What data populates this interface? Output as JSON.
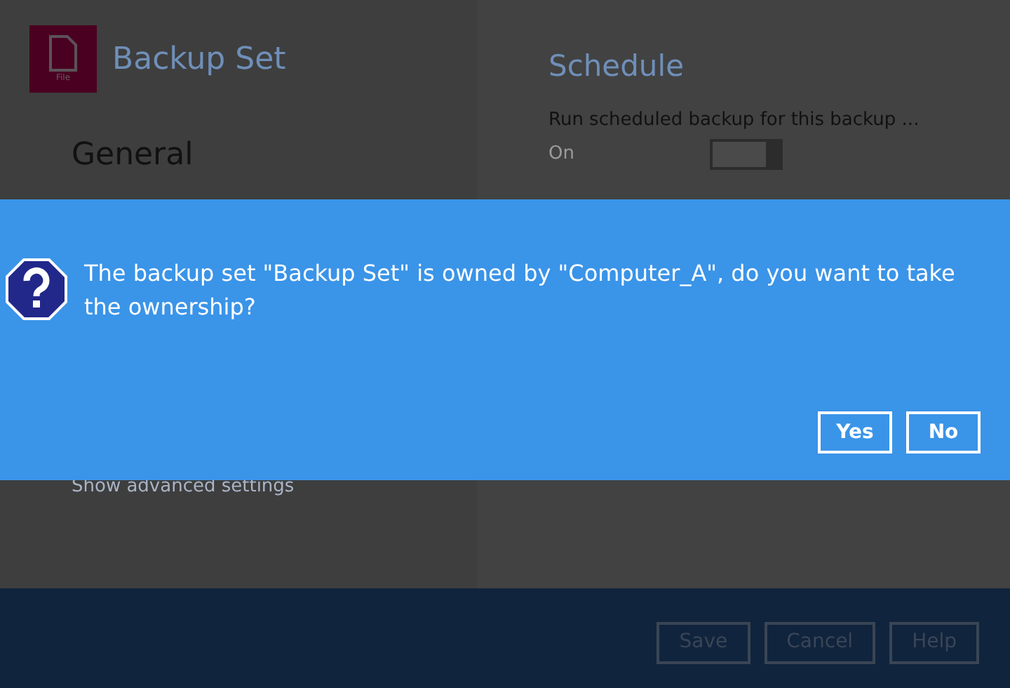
{
  "sidebar": {
    "icon_label": "File",
    "title": "Backup Set",
    "section": "General",
    "advanced_link": "Show advanced settings"
  },
  "schedule": {
    "title": "Schedule",
    "setting_label": "Run scheduled backup for this backup ...",
    "state_label": "On",
    "on": true
  },
  "dialog": {
    "message": "The backup set \"Backup Set\" is owned by \"Computer_A\", do you want to take the ownership?",
    "buttons": [
      "Yes",
      "No"
    ]
  },
  "footer": {
    "buttons": [
      "Save",
      "Cancel",
      "Help"
    ]
  }
}
